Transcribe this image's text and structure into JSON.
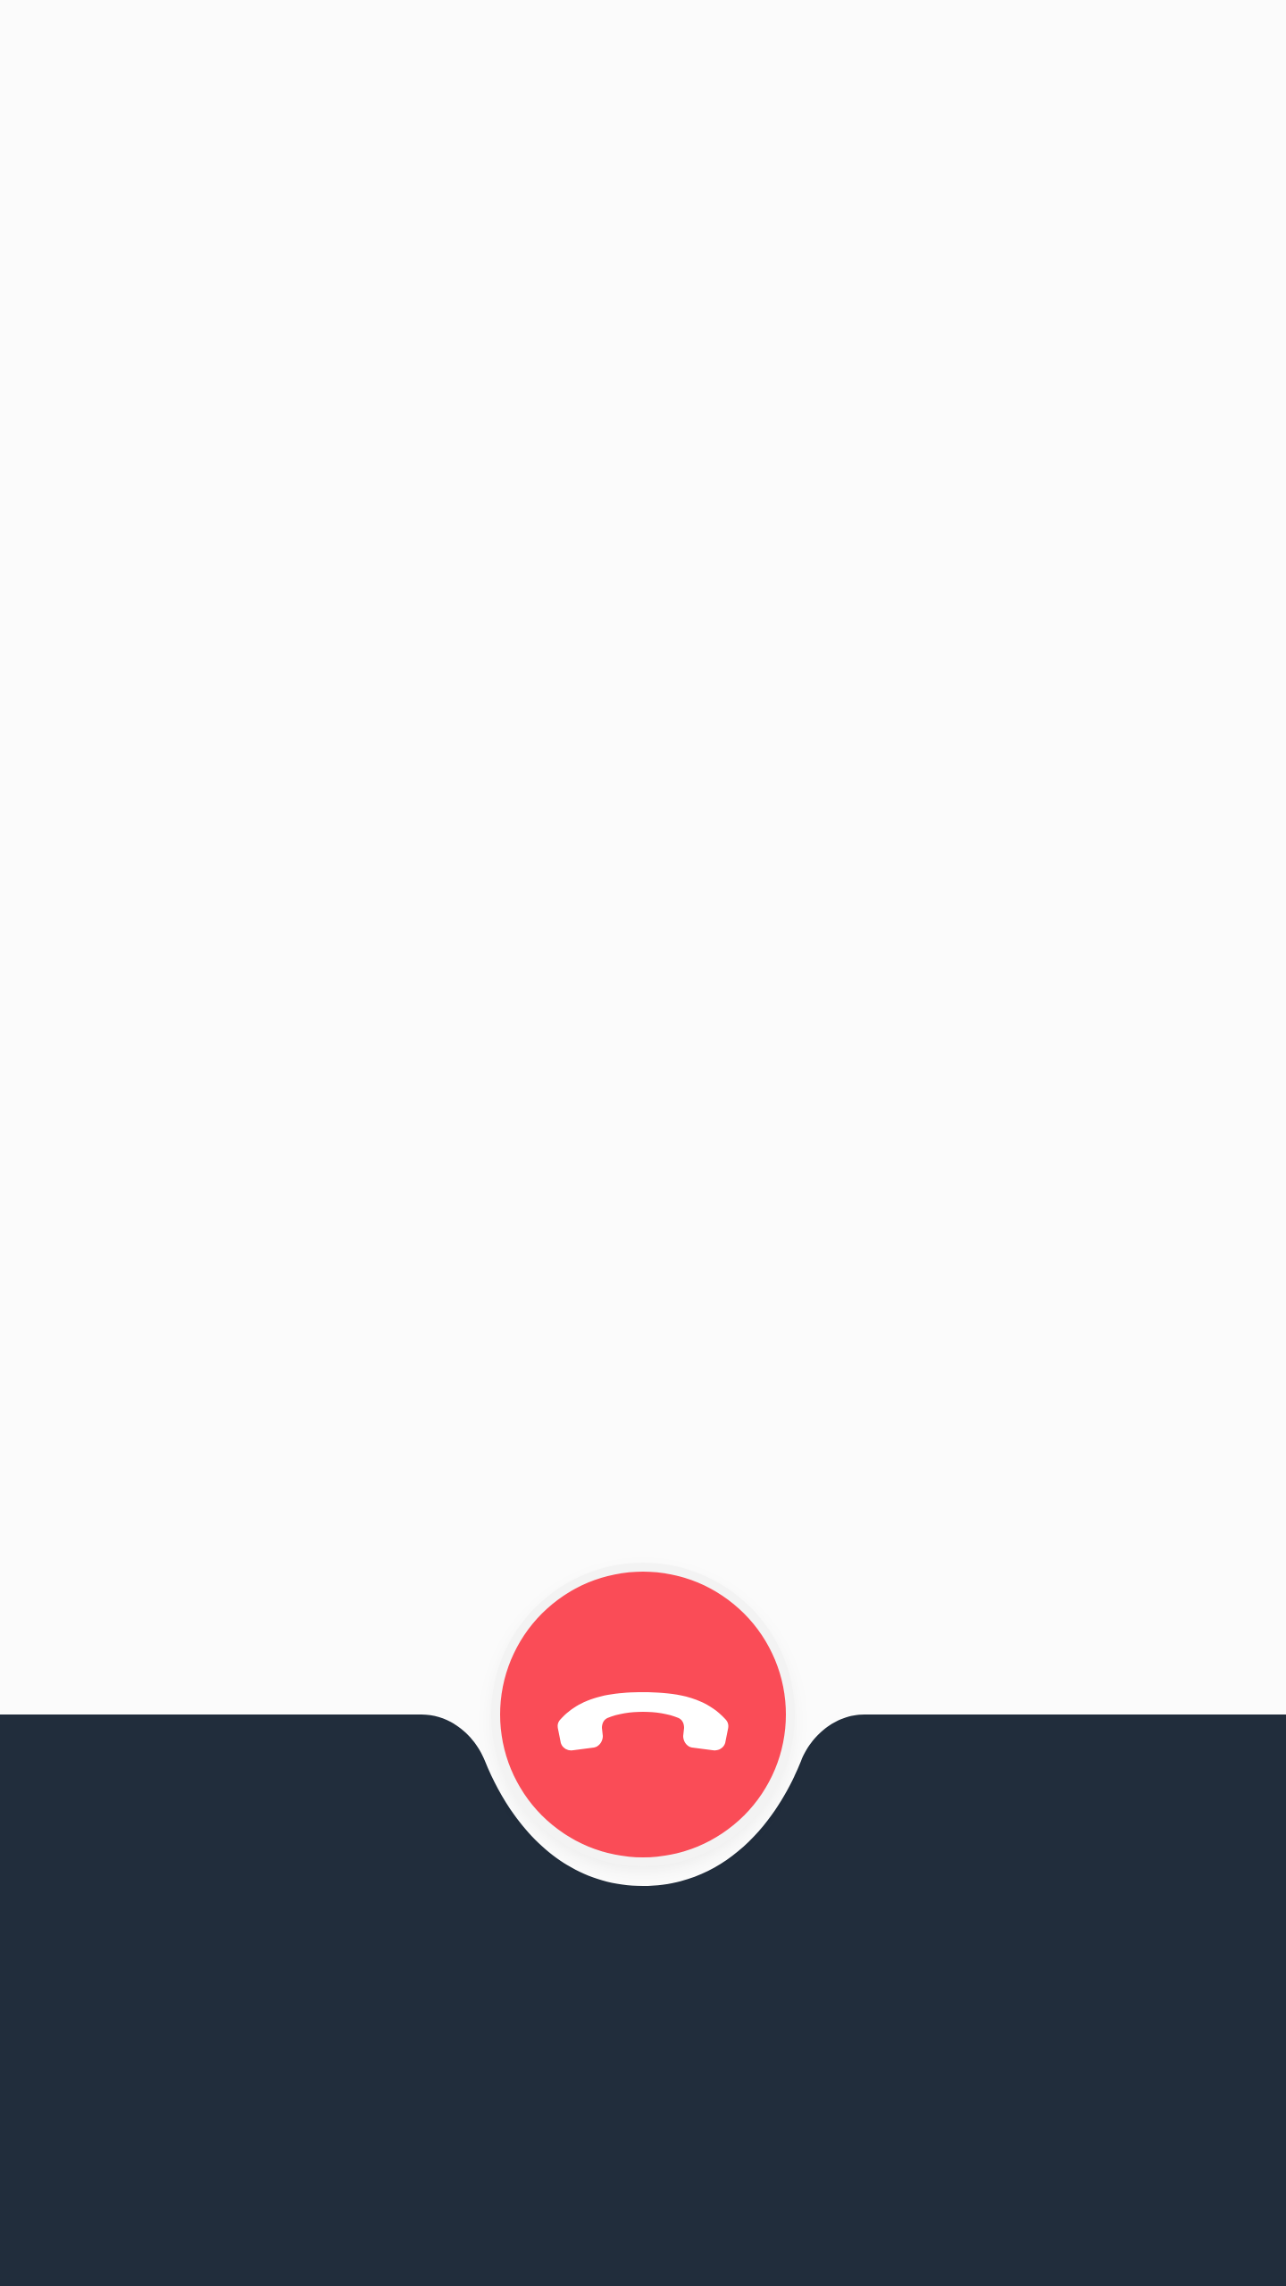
{
  "screen": {
    "background_color": "#fbfbfb",
    "panel_color": "#212d3c"
  },
  "end_call": {
    "icon": "phone-hangup-icon",
    "button_color": "#fa4c57",
    "icon_color": "#ffffff"
  }
}
